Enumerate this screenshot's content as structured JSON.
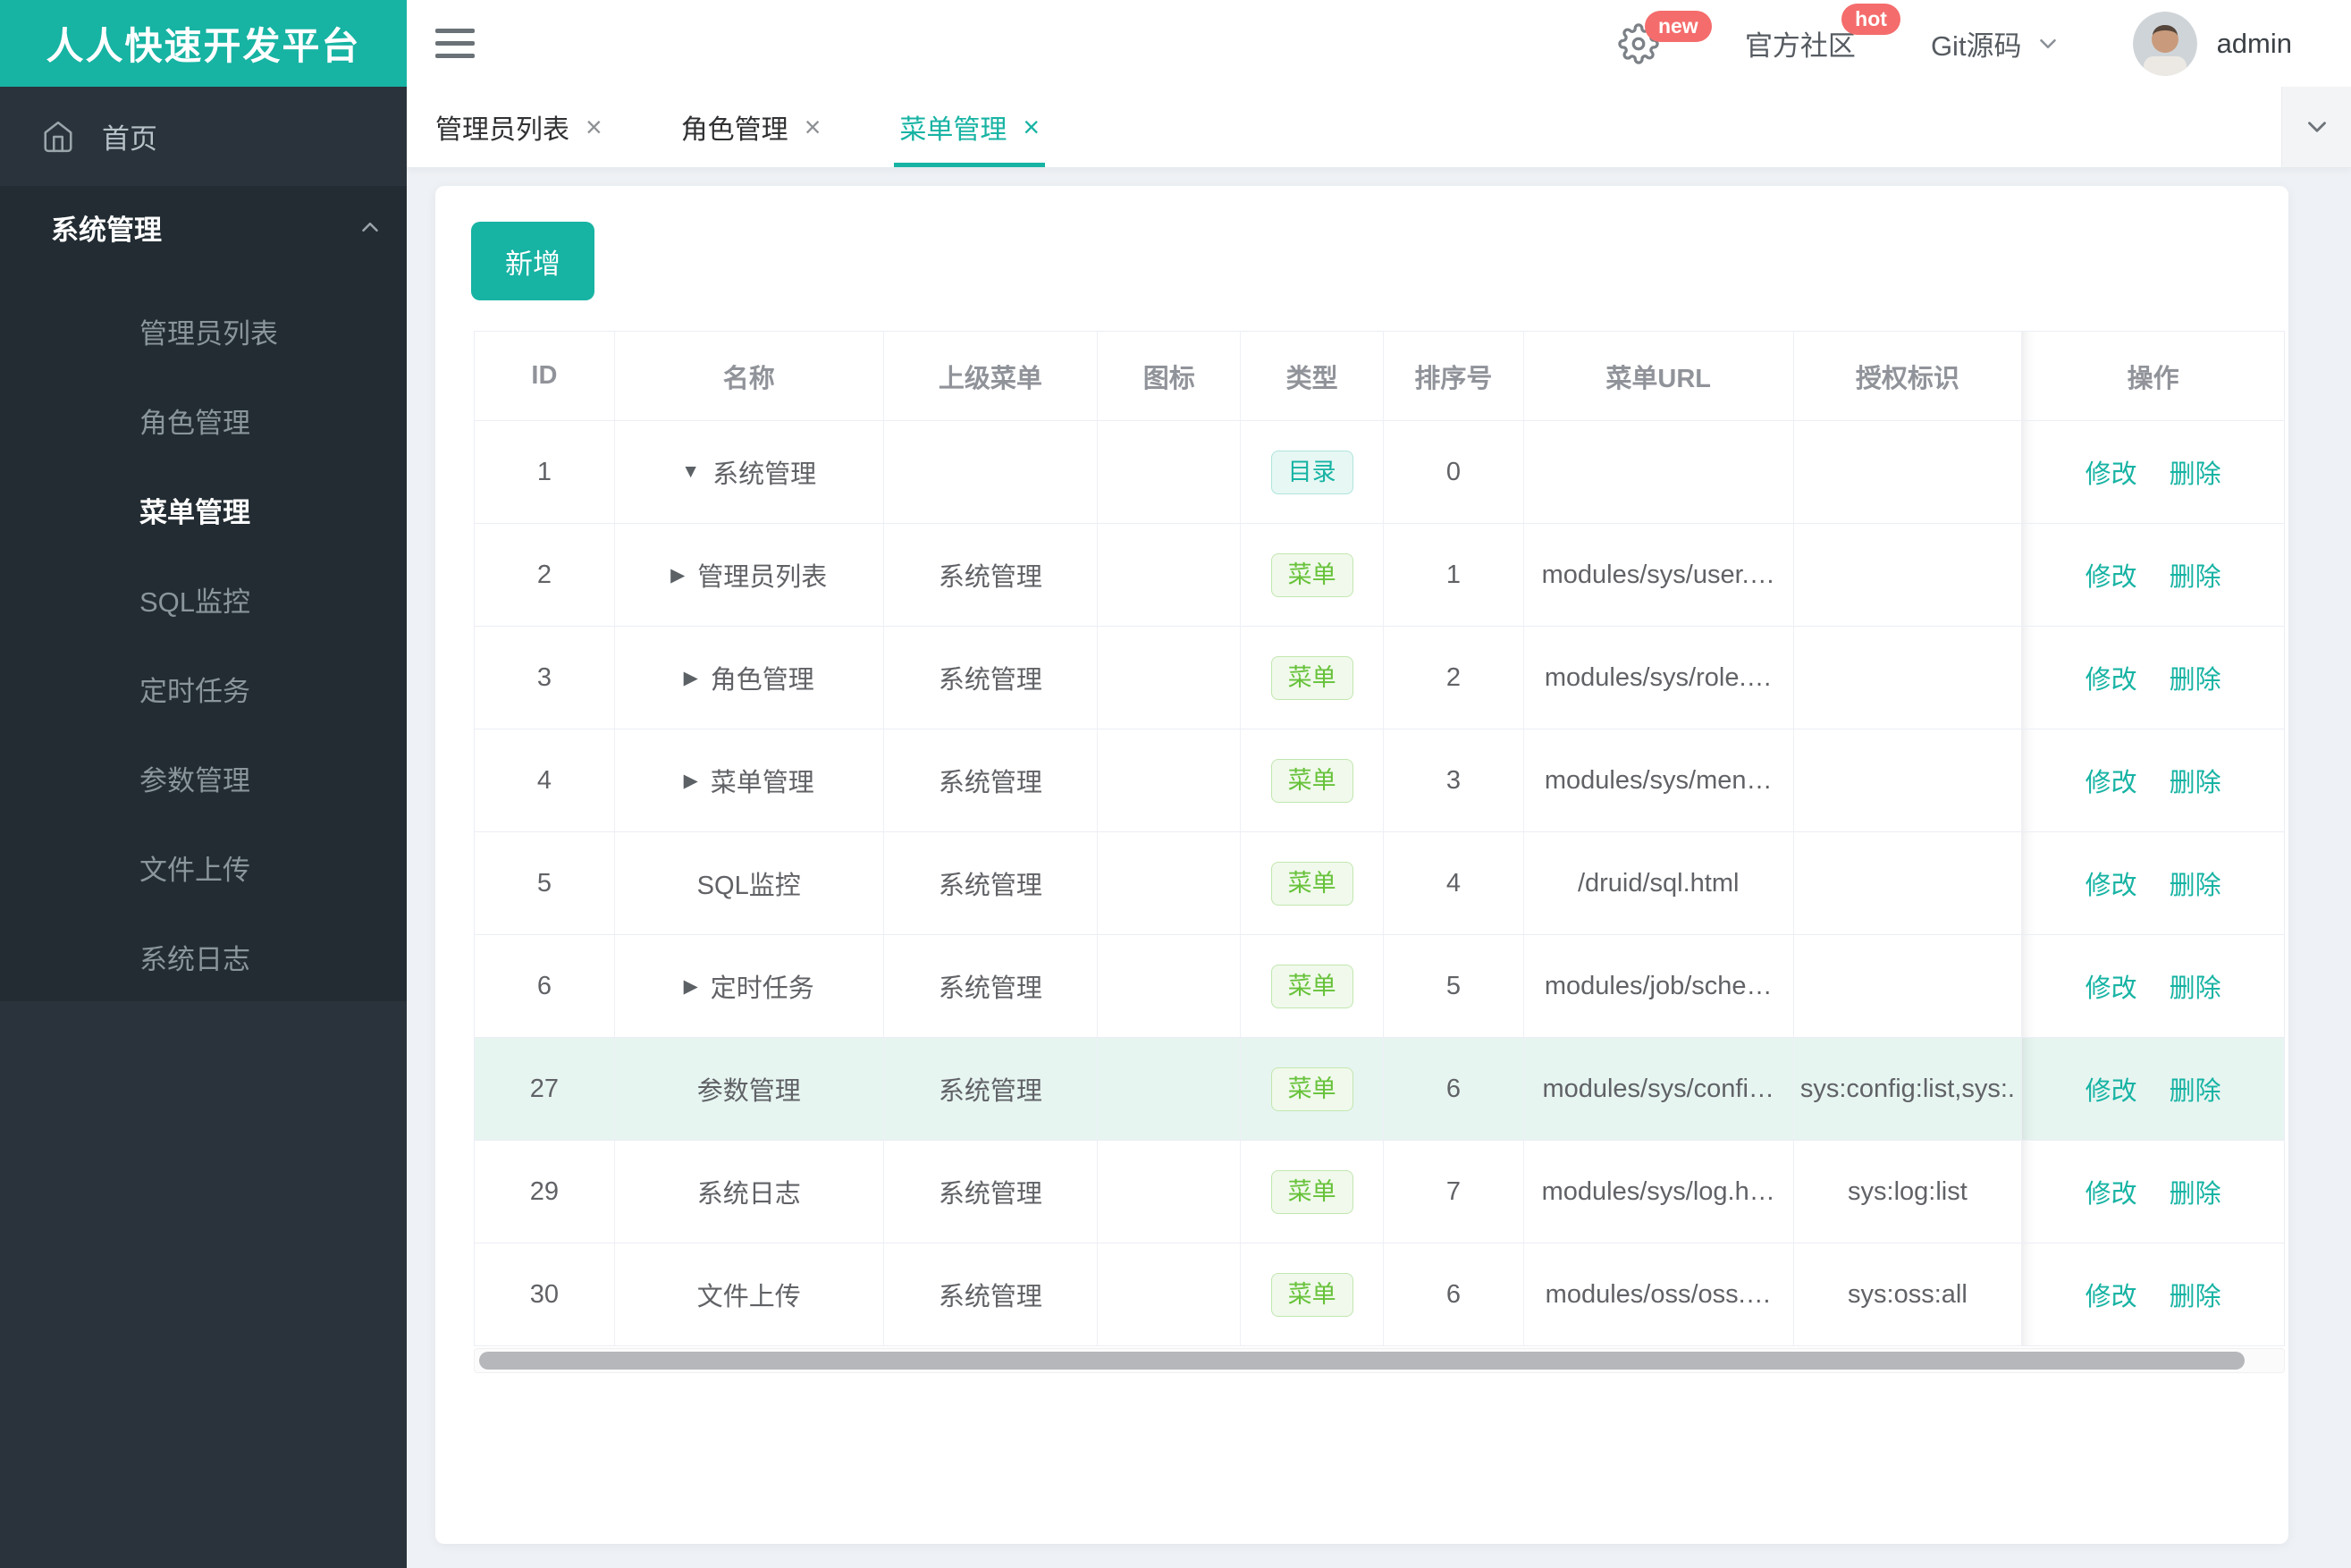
{
  "app": {
    "logo_title": "人人快速开发平台"
  },
  "header": {
    "badge_new": "new",
    "badge_hot": "hot",
    "community_label": "官方社区",
    "git_label": "Git源码",
    "username": "admin"
  },
  "sidebar": {
    "home_label": "首页",
    "group_label": "系统管理",
    "items": [
      {
        "label": "管理员列表",
        "active": false
      },
      {
        "label": "角色管理",
        "active": false
      },
      {
        "label": "菜单管理",
        "active": true
      },
      {
        "label": "SQL监控",
        "active": false
      },
      {
        "label": "定时任务",
        "active": false
      },
      {
        "label": "参数管理",
        "active": false
      },
      {
        "label": "文件上传",
        "active": false
      },
      {
        "label": "系统日志",
        "active": false
      }
    ]
  },
  "tabs": [
    {
      "label": "管理员列表",
      "active": false
    },
    {
      "label": "角色管理",
      "active": false
    },
    {
      "label": "菜单管理",
      "active": true
    }
  ],
  "toolbar": {
    "add_label": "新增"
  },
  "table": {
    "columns": [
      "ID",
      "名称",
      "上级菜单",
      "图标",
      "类型",
      "排序号",
      "菜单URL",
      "授权标识",
      "操作"
    ],
    "type_labels": {
      "dir": "目录",
      "menu": "菜单"
    },
    "action_labels": {
      "edit": "修改",
      "delete": "删除"
    },
    "rows": [
      {
        "id": "1",
        "arrow": "down",
        "name": "系统管理",
        "parent": "",
        "icon": "",
        "type": "dir",
        "sort": "0",
        "url": "",
        "perms": "",
        "highlight": false
      },
      {
        "id": "2",
        "arrow": "right",
        "name": "管理员列表",
        "parent": "系统管理",
        "icon": "",
        "type": "menu",
        "sort": "1",
        "url": "modules/sys/user.…",
        "perms": "",
        "highlight": false
      },
      {
        "id": "3",
        "arrow": "right",
        "name": "角色管理",
        "parent": "系统管理",
        "icon": "",
        "type": "menu",
        "sort": "2",
        "url": "modules/sys/role.…",
        "perms": "",
        "highlight": false
      },
      {
        "id": "4",
        "arrow": "right",
        "name": "菜单管理",
        "parent": "系统管理",
        "icon": "",
        "type": "menu",
        "sort": "3",
        "url": "modules/sys/men…",
        "perms": "",
        "highlight": false
      },
      {
        "id": "5",
        "arrow": "",
        "name": "SQL监控",
        "parent": "系统管理",
        "icon": "",
        "type": "menu",
        "sort": "4",
        "url": "/druid/sql.html",
        "perms": "",
        "highlight": false
      },
      {
        "id": "6",
        "arrow": "right",
        "name": "定时任务",
        "parent": "系统管理",
        "icon": "",
        "type": "menu",
        "sort": "5",
        "url": "modules/job/sche…",
        "perms": "",
        "highlight": false
      },
      {
        "id": "27",
        "arrow": "",
        "name": "参数管理",
        "parent": "系统管理",
        "icon": "",
        "type": "menu",
        "sort": "6",
        "url": "modules/sys/confi…",
        "perms": "sys:config:list,sys:.",
        "highlight": true
      },
      {
        "id": "29",
        "arrow": "",
        "name": "系统日志",
        "parent": "系统管理",
        "icon": "",
        "type": "menu",
        "sort": "7",
        "url": "modules/sys/log.h…",
        "perms": "sys:log:list",
        "highlight": false
      },
      {
        "id": "30",
        "arrow": "",
        "name": "文件上传",
        "parent": "系统管理",
        "icon": "",
        "type": "menu",
        "sort": "6",
        "url": "modules/oss/oss.…",
        "perms": "sys:oss:all",
        "highlight": false
      }
    ]
  },
  "icons": {
    "expand_down": "▼",
    "expand_right": "▶",
    "close_glyph": "×"
  },
  "colors": {
    "primary": "#17b3a3",
    "danger": "#f56c6c",
    "success": "#67c23a"
  }
}
